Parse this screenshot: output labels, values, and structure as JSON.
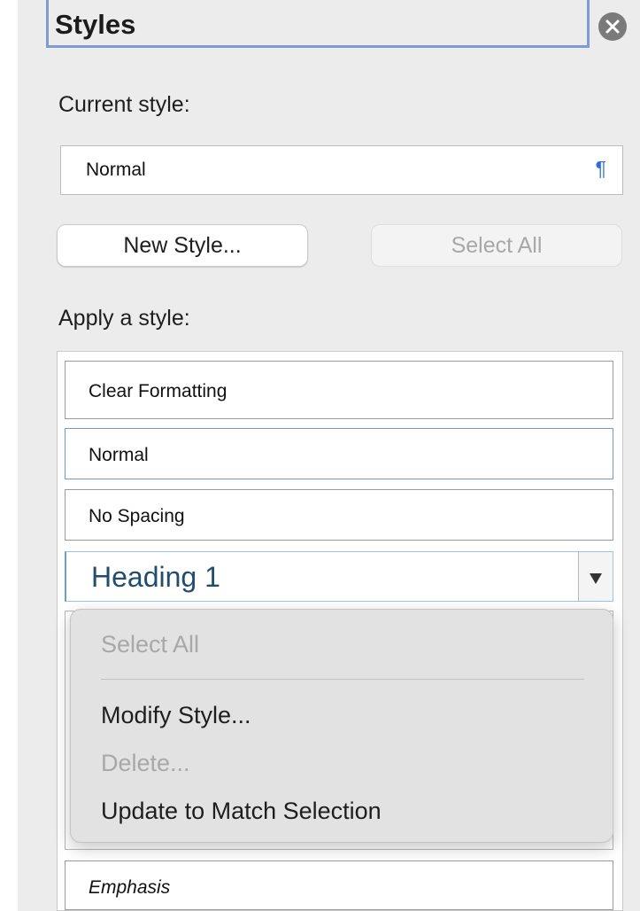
{
  "panel": {
    "title": "Styles",
    "close_icon": "close-circle-icon"
  },
  "current_style": {
    "label": "Current style:",
    "value": "Normal",
    "paragraph_mark": "¶",
    "paragraph_mark_color": "#2f6fd6"
  },
  "buttons": {
    "new_style": "New Style...",
    "select_all": "Select All"
  },
  "apply": {
    "label": "Apply a style:",
    "items": [
      {
        "label": "Clear Formatting"
      },
      {
        "label": "Normal"
      },
      {
        "label": "No Spacing"
      },
      {
        "label": "Heading 1"
      },
      {
        "label": "Emphasis"
      }
    ],
    "heading_color": "#224d6e"
  },
  "context_menu": {
    "items": [
      {
        "label": "Select All",
        "enabled": false
      },
      {
        "label": "Modify Style...",
        "enabled": true
      },
      {
        "label": "Delete...",
        "enabled": false
      },
      {
        "label": "Update to Match Selection",
        "enabled": true
      }
    ]
  }
}
